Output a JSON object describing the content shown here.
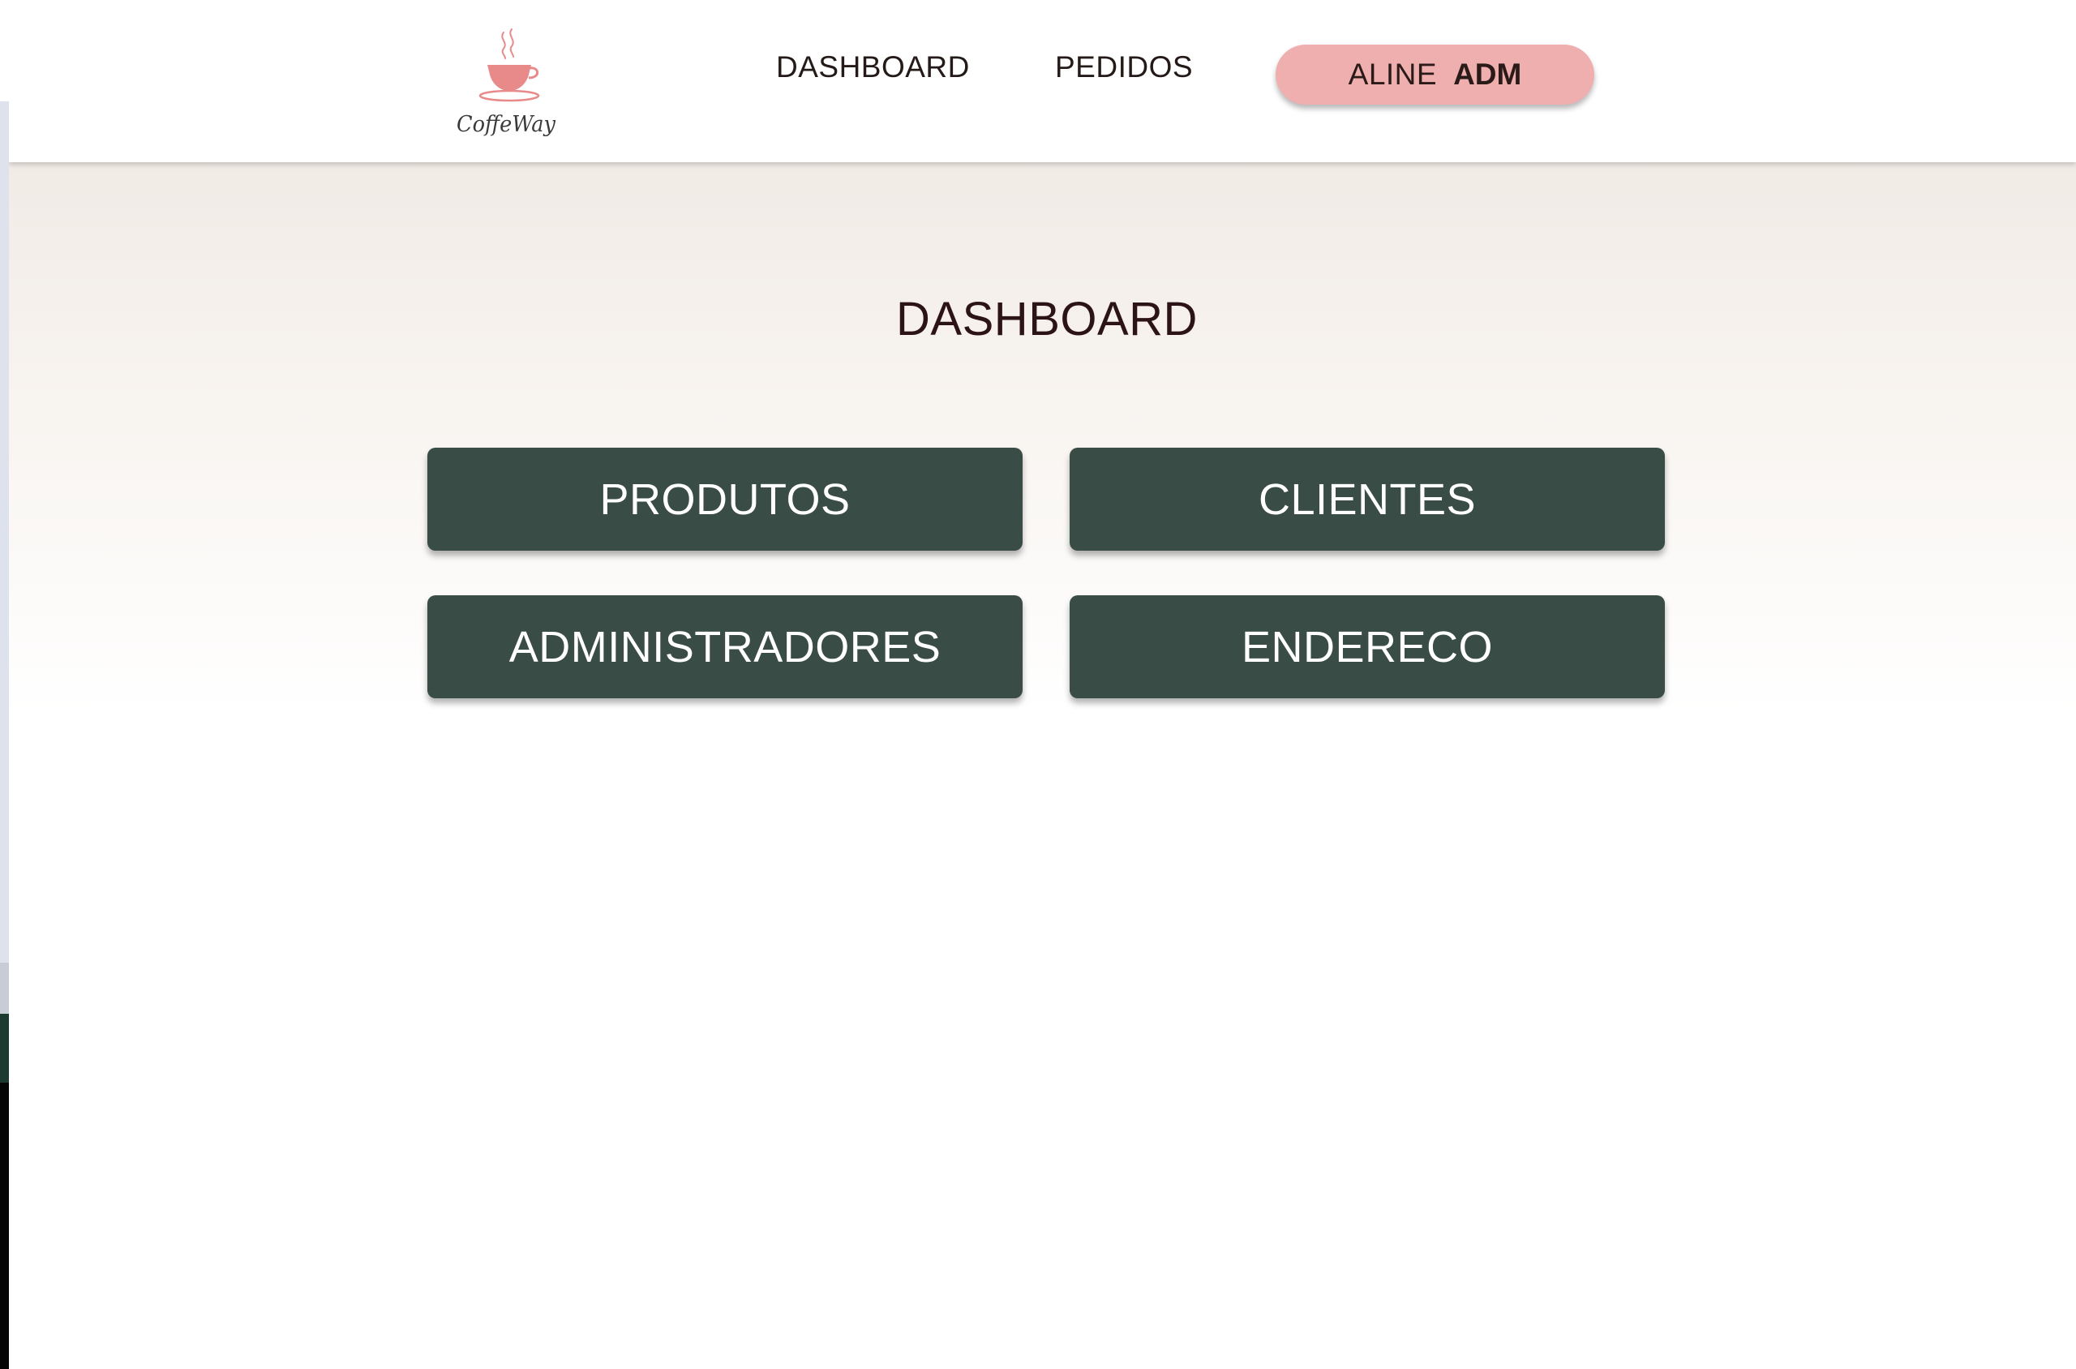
{
  "brand": {
    "logo_text": "CoffeWay",
    "logo_icon": "coffee-cup-icon",
    "logo_color": "#e98a8a"
  },
  "nav": {
    "items": [
      {
        "label": "DASHBOARD"
      },
      {
        "label": "PEDIDOS"
      }
    ],
    "user": {
      "name": "ALINE",
      "role": "ADM"
    }
  },
  "main": {
    "title": "DASHBOARD",
    "buttons": [
      {
        "label": "PRODUTOS"
      },
      {
        "label": "CLIENTES"
      },
      {
        "label": "ADMINISTRADORES"
      },
      {
        "label": "ENDERECO"
      }
    ]
  },
  "colors": {
    "button_bg": "#394c46",
    "user_pill_bg": "#efafae",
    "title_text": "#2c1416"
  }
}
